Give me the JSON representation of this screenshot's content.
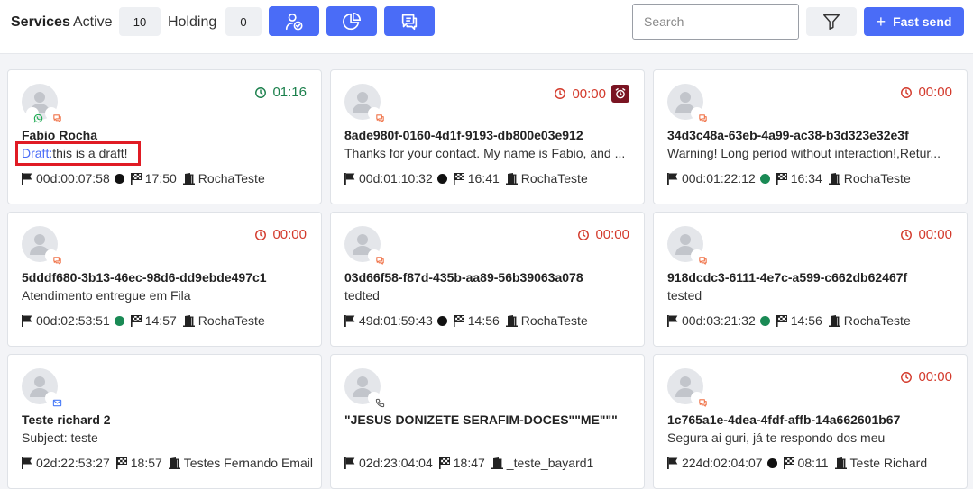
{
  "header": {
    "title": "Services",
    "active_label": "Active",
    "active_count": "10",
    "holding_label": "Holding",
    "holding_count": "0",
    "search_placeholder": "Search",
    "fast_send_label": "Fast send",
    "accent_color": "#4a6cf7"
  },
  "cards": [
    {
      "name": "Fabio Rocha",
      "draft_label": "Draft:",
      "message": "this is a draft!",
      "timer": "01:16",
      "timer_status": "green",
      "alarm": false,
      "channels": [
        "whatsapp-icon",
        "chat-icon"
      ],
      "duration": "00d:00:07:58",
      "dot_color": "#111111",
      "time": "17:50",
      "queue": "RochaTeste"
    },
    {
      "name": "8ade980f-0160-4d1f-9193-db800e03e912",
      "message": "Thanks for your contact. My name is Fabio, and ...",
      "timer": "00:00",
      "timer_status": "red",
      "alarm": true,
      "channels": [
        "chat-icon"
      ],
      "duration": "00d:01:10:32",
      "dot_color": "#111111",
      "time": "16:41",
      "queue": "RochaTeste"
    },
    {
      "name": "34d3c48a-63eb-4a99-ac38-b3d323e32e3f",
      "message": "Warning! Long period without interaction!,Retur...",
      "timer": "00:00",
      "timer_status": "red",
      "alarm": false,
      "channels": [
        "chat-icon"
      ],
      "duration": "00d:01:22:12",
      "dot_color": "#1a8a55",
      "time": "16:34",
      "queue": "RochaTeste"
    },
    {
      "name": "5dddf680-3b13-46ec-98d6-dd9ebde497c1",
      "message": "Atendimento entregue em Fila",
      "timer": "00:00",
      "timer_status": "red",
      "alarm": false,
      "channels": [
        "chat-icon"
      ],
      "duration": "00d:02:53:51",
      "dot_color": "#1a8a55",
      "time": "14:57",
      "queue": "RochaTeste"
    },
    {
      "name": "03d66f58-f87d-435b-aa89-56b39063a078",
      "message": "tedted",
      "timer": "00:00",
      "timer_status": "red",
      "alarm": false,
      "channels": [
        "chat-icon"
      ],
      "duration": "49d:01:59:43",
      "dot_color": "#111111",
      "time": "14:56",
      "queue": "RochaTeste"
    },
    {
      "name": "918dcdc3-6111-4e7c-a599-c662db62467f",
      "message": "tested",
      "timer": "00:00",
      "timer_status": "red",
      "alarm": false,
      "channels": [
        "chat-icon"
      ],
      "duration": "00d:03:21:32",
      "dot_color": "#1a8a55",
      "time": "14:56",
      "queue": "RochaTeste"
    },
    {
      "name": "Teste richard 2",
      "message": "Subject: teste",
      "timer": "",
      "timer_status": "none",
      "alarm": false,
      "channels": [
        "email-icon"
      ],
      "duration": "02d:22:53:27",
      "dot_color": "",
      "time": "18:57",
      "queue": "Testes Fernando Email"
    },
    {
      "name": "\"JESUS DONIZETE SERAFIM-DOCES\"\"ME\"\"\"",
      "message": "",
      "timer": "",
      "timer_status": "none",
      "alarm": false,
      "channels": [
        "phone-icon"
      ],
      "duration": "02d:23:04:04",
      "dot_color": "",
      "time": "18:47",
      "queue": "_teste_bayard1"
    },
    {
      "name": "1c765a1e-4dea-4fdf-affb-14a662601b67",
      "message": "Segura ai guri, já te respondo dos meu",
      "timer": "00:00",
      "timer_status": "red",
      "alarm": false,
      "channels": [
        "chat-icon"
      ],
      "duration": "224d:02:04:07",
      "dot_color": "#111111",
      "time": "08:11",
      "queue": "Teste Richard"
    }
  ]
}
